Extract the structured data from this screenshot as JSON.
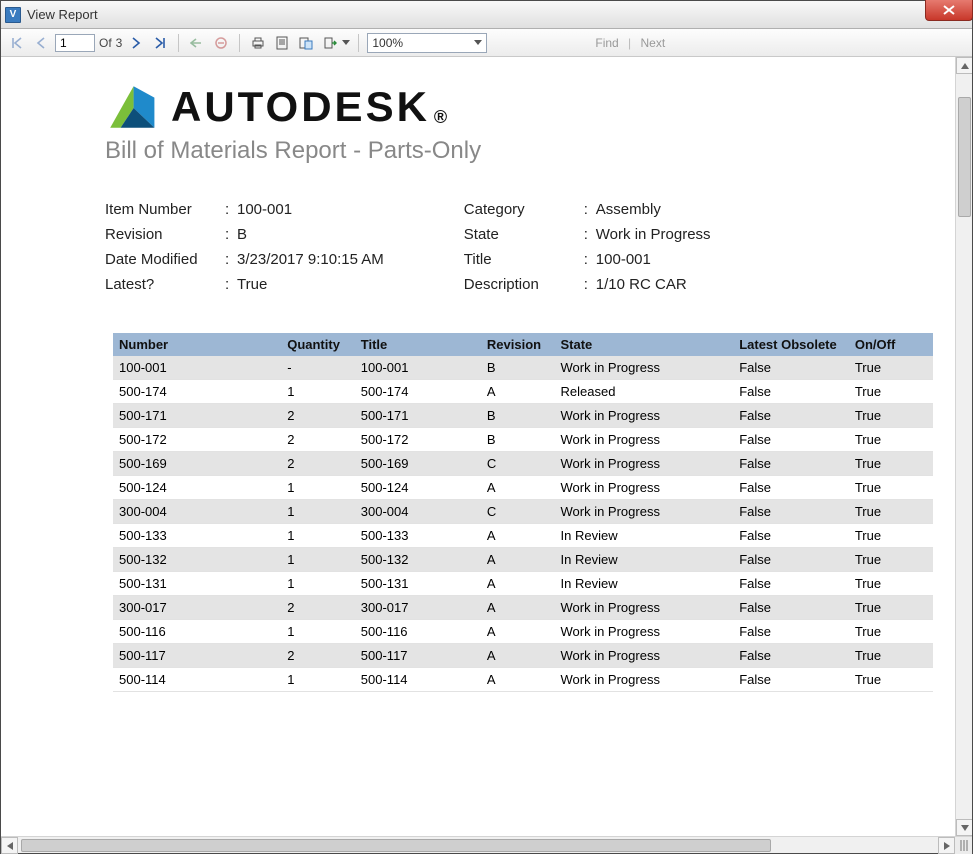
{
  "window": {
    "title": "View Report",
    "close_icon": "close-icon"
  },
  "toolbar": {
    "current_page": "1",
    "of_label": "Of",
    "total_pages": "3",
    "zoom": "100%",
    "find_label": "Find",
    "next_label": "Next"
  },
  "report": {
    "brand": "AUTODESK",
    "subtitle": "Bill of Materials Report - Parts-Only",
    "meta_left": [
      {
        "label": "Item Number",
        "value": "100-001"
      },
      {
        "label": "Revision",
        "value": "B"
      },
      {
        "label": "Date Modified",
        "value": "3/23/2017 9:10:15 AM"
      },
      {
        "label": "Latest?",
        "value": "True"
      }
    ],
    "meta_right": [
      {
        "label": "Category",
        "value": "Assembly"
      },
      {
        "label": "State",
        "value": "Work in Progress"
      },
      {
        "label": "Title",
        "value": "100-001"
      },
      {
        "label": "Description",
        "value": "1/10 RC CAR"
      }
    ],
    "columns": [
      "Number",
      "Quantity",
      "Title",
      "Revision",
      "State",
      "Latest Obsolete",
      "On/Off"
    ],
    "rows": [
      {
        "number": "100-001",
        "quantity": "-",
        "title": "100-001",
        "revision": "B",
        "state": "Work in Progress",
        "latest_obsolete": "False",
        "onoff": "True"
      },
      {
        "number": "500-174",
        "quantity": "1",
        "title": "500-174",
        "revision": "A",
        "state": "Released",
        "latest_obsolete": "False",
        "onoff": "True"
      },
      {
        "number": "500-171",
        "quantity": "2",
        "title": "500-171",
        "revision": "B",
        "state": "Work in Progress",
        "latest_obsolete": "False",
        "onoff": "True"
      },
      {
        "number": "500-172",
        "quantity": "2",
        "title": "500-172",
        "revision": "B",
        "state": "Work in Progress",
        "latest_obsolete": "False",
        "onoff": "True"
      },
      {
        "number": "500-169",
        "quantity": "2",
        "title": "500-169",
        "revision": "C",
        "state": "Work in Progress",
        "latest_obsolete": "False",
        "onoff": "True"
      },
      {
        "number": "500-124",
        "quantity": "1",
        "title": "500-124",
        "revision": "A",
        "state": "Work in Progress",
        "latest_obsolete": "False",
        "onoff": "True"
      },
      {
        "number": "300-004",
        "quantity": "1",
        "title": "300-004",
        "revision": "C",
        "state": "Work in Progress",
        "latest_obsolete": "False",
        "onoff": "True"
      },
      {
        "number": "500-133",
        "quantity": "1",
        "title": "500-133",
        "revision": "A",
        "state": "In Review",
        "latest_obsolete": "False",
        "onoff": "True"
      },
      {
        "number": "500-132",
        "quantity": "1",
        "title": "500-132",
        "revision": "A",
        "state": "In Review",
        "latest_obsolete": "False",
        "onoff": "True"
      },
      {
        "number": "500-131",
        "quantity": "1",
        "title": "500-131",
        "revision": "A",
        "state": "In Review",
        "latest_obsolete": "False",
        "onoff": "True"
      },
      {
        "number": "300-017",
        "quantity": "2",
        "title": "300-017",
        "revision": "A",
        "state": "Work in Progress",
        "latest_obsolete": "False",
        "onoff": "True"
      },
      {
        "number": "500-116",
        "quantity": "1",
        "title": "500-116",
        "revision": "A",
        "state": "Work in Progress",
        "latest_obsolete": "False",
        "onoff": "True"
      },
      {
        "number": "500-117",
        "quantity": "2",
        "title": "500-117",
        "revision": "A",
        "state": "Work in Progress",
        "latest_obsolete": "False",
        "onoff": "True"
      },
      {
        "number": "500-114",
        "quantity": "1",
        "title": "500-114",
        "revision": "A",
        "state": "Work in Progress",
        "latest_obsolete": "False",
        "onoff": "True"
      }
    ]
  }
}
